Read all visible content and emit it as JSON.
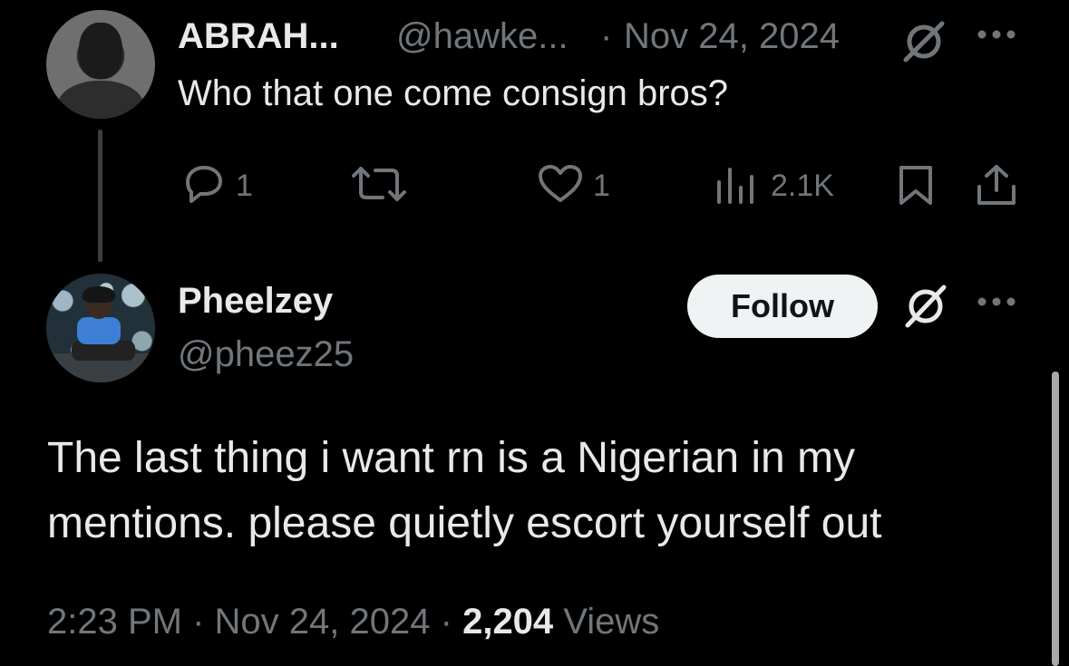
{
  "parent_tweet": {
    "author_name": "ABRAH...",
    "handle": "@hawke...",
    "separator": "·",
    "date": "Nov 24, 2024",
    "text": "Who that one come consign bros?",
    "actions": {
      "replies": "1",
      "likes": "1",
      "views": "2.1K"
    },
    "icons": {
      "grok": "grok-icon",
      "more": "more-icon",
      "reply": "reply-icon",
      "retweet": "retweet-icon",
      "like": "heart-icon",
      "views": "views-chart-icon",
      "bookmark": "bookmark-icon",
      "share": "share-icon"
    }
  },
  "reply_tweet": {
    "author_name": "Pheelzey",
    "handle": "@pheez25",
    "follow_label": "Follow",
    "text": "The last thing i want rn is a Nigerian in my mentions. please quietly escort yourself out",
    "time": "2:23 PM",
    "separator": "·",
    "date": "Nov 24, 2024",
    "views_count": "2,204",
    "views_label": "Views"
  },
  "colors": {
    "background": "#000000",
    "primary_text": "#e7e9ea",
    "secondary_text": "#71767b",
    "follow_button_bg": "#eff3f4",
    "follow_button_text": "#0f1419"
  }
}
